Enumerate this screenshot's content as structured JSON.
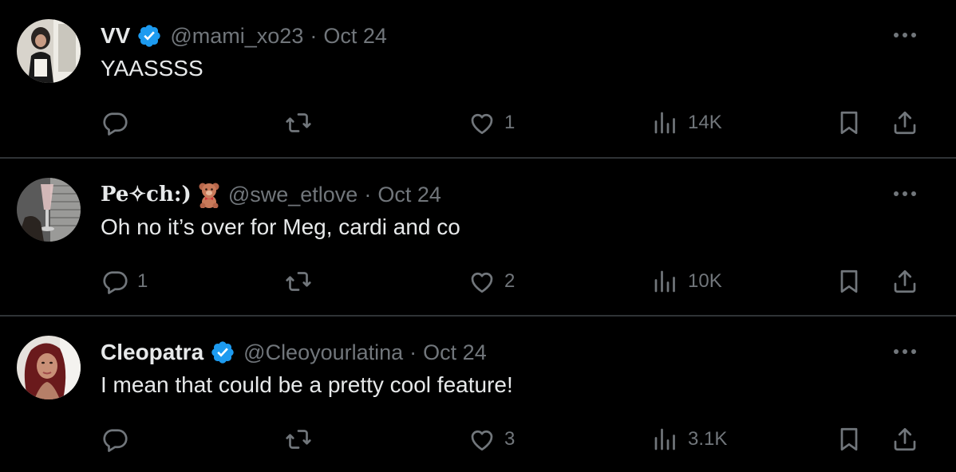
{
  "colors": {
    "background": "#000000",
    "primary_text": "#e7e9ea",
    "secondary_text": "#71767b",
    "divider": "#2f3336",
    "verified_blue": "#1d9bf0"
  },
  "tweets": [
    {
      "name": "VV",
      "verified": true,
      "handle": "@mami_xo23",
      "separator": "·",
      "date": "Oct 24",
      "text": "YAASSSS",
      "replies": "",
      "retweets": "",
      "likes": "1",
      "views": "14K"
    },
    {
      "name": "Pe✧ch:)",
      "verified": false,
      "emoji": "teddy-bear",
      "handle": "@swe_etlove",
      "separator": "·",
      "date": "Oct 24",
      "text": "Oh no it’s over for Meg, cardi and co",
      "replies": "1",
      "retweets": "",
      "likes": "2",
      "views": "10K"
    },
    {
      "name": "Cleopatra",
      "verified": true,
      "handle": "@Cleoyourlatina",
      "separator": "·",
      "date": "Oct 24",
      "text": "I mean that could be a pretty cool feature!",
      "replies": "",
      "retweets": "",
      "likes": "3",
      "views": "3.1K"
    }
  ],
  "icons": {
    "reply": "reply-icon",
    "retweet": "retweet-icon",
    "like": "heart-icon",
    "views": "views-icon",
    "bookmark": "bookmark-icon",
    "share": "share-icon",
    "more": "more-icon",
    "verified": "verified-badge-icon"
  }
}
